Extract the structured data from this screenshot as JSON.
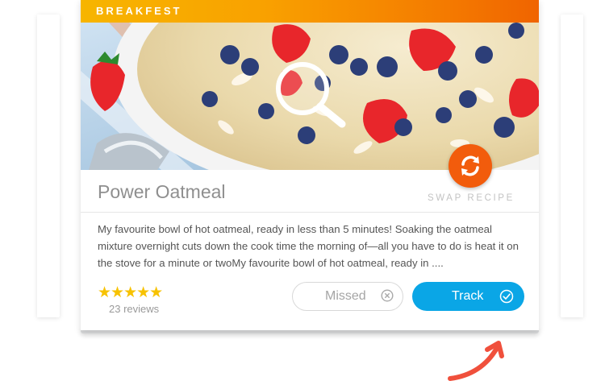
{
  "card": {
    "category": "BREAKFEST",
    "title": "Power Oatmeal",
    "swap_label": "SWAP RECIPE",
    "description": "My favourite bowl of hot oatmeal, ready in less than 5 minutes! Soaking the oatmeal mixture overnight cuts down the cook time the morning of—all you have to do is heat it on the stove for a minute or twoMy favourite bowl of hot oatmeal, ready in ....",
    "rating": {
      "stars": "★★★★★",
      "value": 5,
      "reviews": "23 reviews"
    },
    "missed_label": "Missed",
    "track_label": "Track"
  },
  "icons": {
    "zoom": "magnifier-icon",
    "swap": "refresh-icon",
    "missed": "close-circle-icon",
    "track": "check-circle-icon",
    "annotation": "curved-arrow-icon"
  },
  "colors": {
    "banner_start": "#f7b500",
    "banner_end": "#f06400",
    "swap_button": "#f25c0c",
    "track_button": "#0aa6e6",
    "stars": "#f7c200",
    "arrow": "#f0503c"
  }
}
